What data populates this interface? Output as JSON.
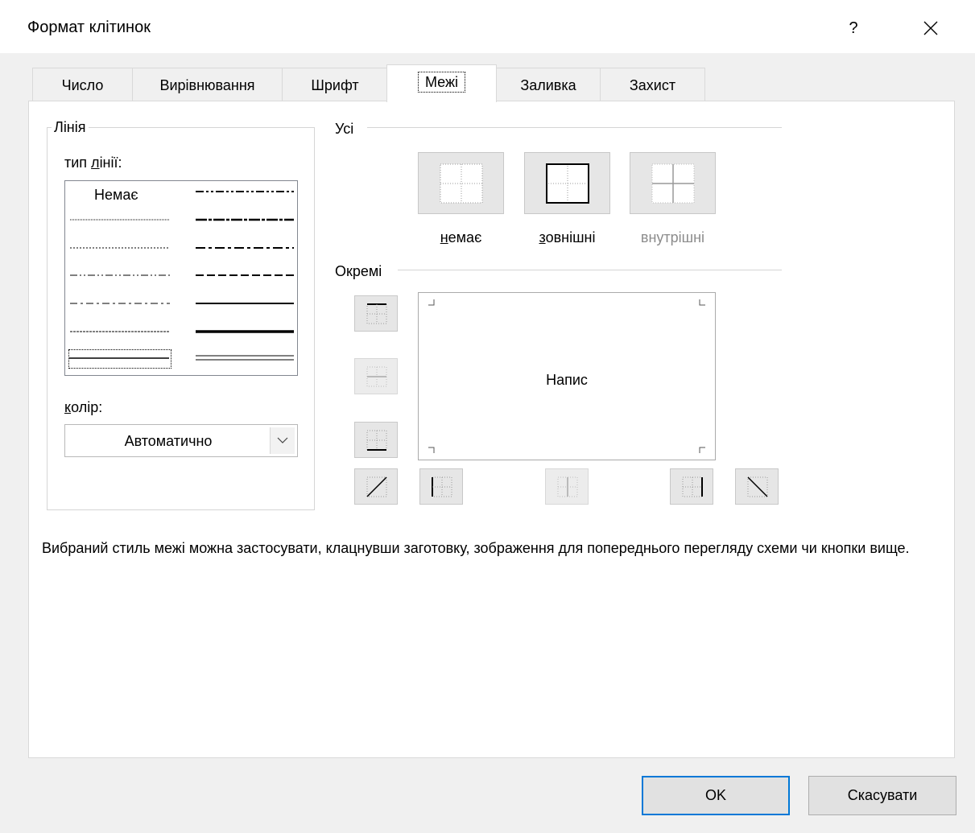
{
  "window": {
    "title": "Формат клітинок",
    "help": "?"
  },
  "tabs": [
    "Число",
    "Вирівнювання",
    "Шрифт",
    "Межі",
    "Заливка",
    "Захист"
  ],
  "active_tab": "Межі",
  "line_group": {
    "title": "Лінія",
    "style_label_pre": "тип ",
    "style_label_u": "л",
    "style_label_post": "інії:",
    "none_style": "Немає",
    "color_label_u": "к",
    "color_label_post": "олір:",
    "color_value": "Автоматично"
  },
  "presets_group": {
    "title": "Усі",
    "none_u": "н",
    "none_post": "емає",
    "outline_u": "з",
    "outline_pre": "",
    "outline_post": "овнішні",
    "inside": "внутрішні"
  },
  "border_group": {
    "title": "Окремі",
    "preview_text": "Напис"
  },
  "hint": "Вибраний стиль межі можна застосувати, клацнувши заготовку, зображення для попереднього перегляду схеми чи кнопки вище.",
  "buttons": {
    "ok": "OK",
    "cancel": "Скасувати"
  },
  "colors": {
    "accent": "#0078d7",
    "panel": "#ffffff",
    "background": "#f0f0f0"
  }
}
